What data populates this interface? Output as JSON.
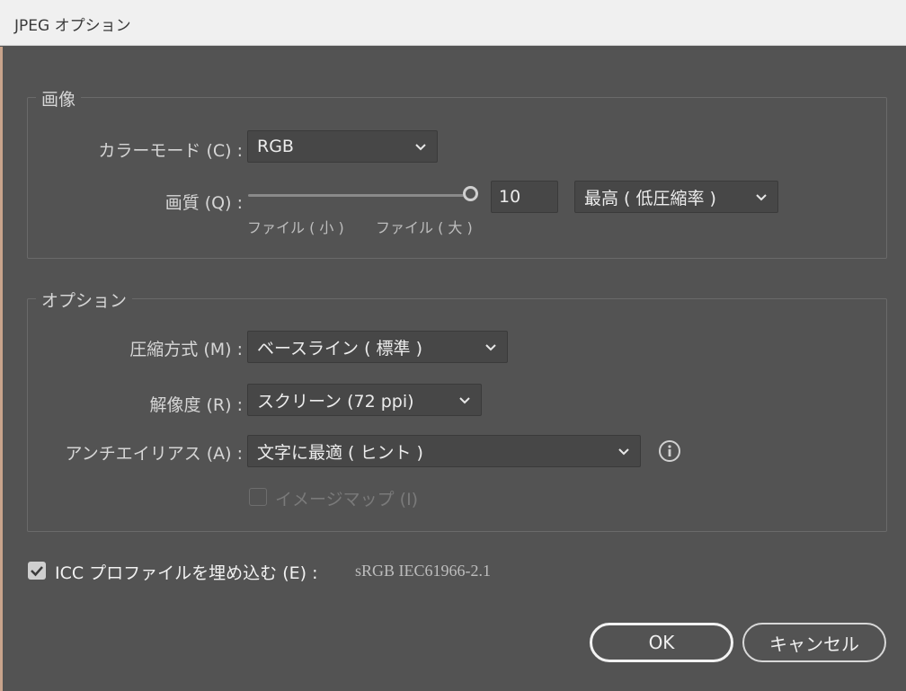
{
  "window": {
    "title": "JPEG オプション"
  },
  "image_group": {
    "title": "画像",
    "color_mode": {
      "label": "カラーモード (C) :",
      "value": "RGB"
    },
    "quality": {
      "label": "画質 (Q) :",
      "value": "10",
      "level_fraction": 1.0,
      "preset": "最高 ( 低圧縮率 )",
      "hint_small": "ファイル ( 小 )",
      "hint_large": "ファイル ( 大 )"
    }
  },
  "options_group": {
    "title": "オプション",
    "compression": {
      "label": "圧縮方式 (M) :",
      "value": "ベースライン ( 標準 )"
    },
    "resolution": {
      "label": "解像度 (R) :",
      "value": "スクリーン (72 ppi)"
    },
    "antialias": {
      "label": "アンチエイリアス (A) :",
      "value": "文字に最適 ( ヒント )"
    },
    "imagemap": {
      "label": "イメージマップ (I)",
      "checked": false,
      "enabled": false
    }
  },
  "icc": {
    "label": "ICC プロファイルを埋め込む (E) :",
    "profile": "sRGB IEC61966-2.1",
    "checked": true
  },
  "buttons": {
    "ok": "OK",
    "cancel": "キャンセル"
  },
  "colors": {
    "background": "#535353",
    "field": "#474747",
    "text": "#d6d6d6",
    "titlebar": "#f0f0f0"
  },
  "icons": [
    "chevron-down-icon",
    "info-icon",
    "checkmark-icon"
  ]
}
